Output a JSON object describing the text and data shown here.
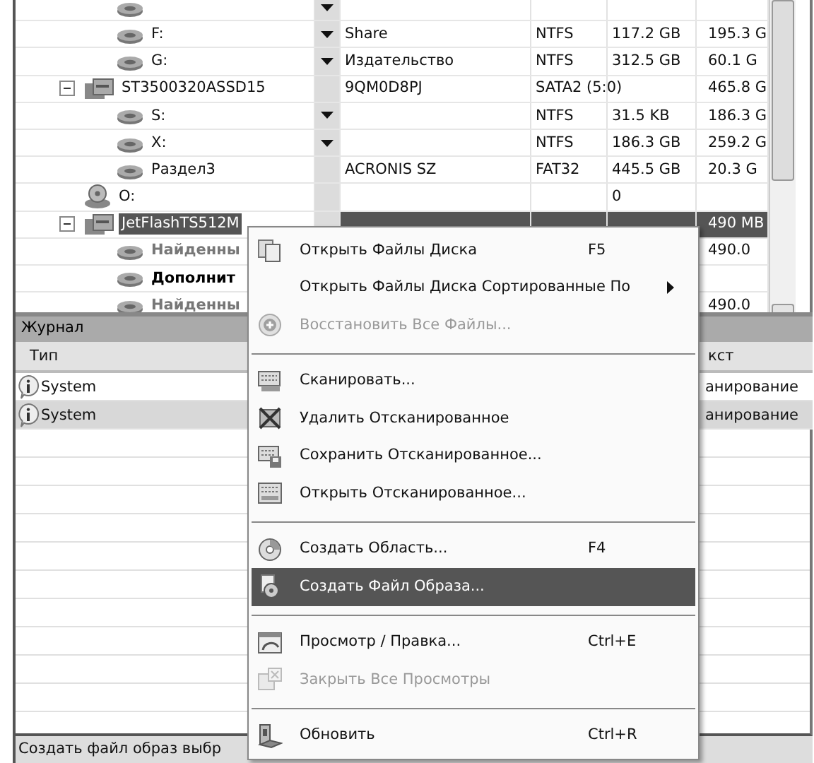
{
  "tree": [
    {
      "children": [
        {
          "kind": "partition",
          "dropdown": true,
          "selected": false
        },
        {
          "kind": "partition",
          "name": "F:",
          "dropdown": true,
          "label": "Share",
          "fs": "NTFS",
          "size": "117.2 GB",
          "total": "195.3 G",
          "selected": false
        },
        {
          "kind": "partition",
          "name": "G:",
          "dropdown": true,
          "label": "Издательство",
          "fs": "NTFS",
          "size": "312.5 GB",
          "total": "60.1 G",
          "selected": false
        }
      ]
    },
    {
      "kind": "disk",
      "name": "ST3500320ASSD15",
      "expanded": true,
      "label": "9QM0D8PJ",
      "fs": "SATA2 (5:0)",
      "total": "465.8 G",
      "selected": false,
      "children": [
        {
          "kind": "partition",
          "name": "S:",
          "dropdown": true,
          "fs": "NTFS",
          "size": "31.5 KB",
          "total": "186.3 G",
          "selected": false
        },
        {
          "kind": "partition",
          "name": "X:",
          "dropdown": true,
          "fs": "NTFS",
          "size": "186.3 GB",
          "total": "259.2 G",
          "selected": false
        },
        {
          "kind": "partition",
          "name": "Раздел3",
          "dropdown": false,
          "label": "ACRONIS SZ",
          "fs": "FAT32",
          "size": "445.5 GB",
          "total": "20.3 G",
          "selected": false
        }
      ]
    },
    {
      "kind": "optical",
      "name": "O:",
      "size": "0",
      "selected": false
    },
    {
      "kind": "disk",
      "name": "JetFlashTS512M",
      "expanded": true,
      "total": "490 MB",
      "selected": true,
      "children": [
        {
          "kind": "found",
          "name": "Найденны",
          "total": "490.0",
          "selected": false
        },
        {
          "kind": "additional",
          "name": "Дополнит",
          "selected": false
        },
        {
          "kind": "found",
          "name": "Найденны",
          "total": "490.0",
          "selected": false
        }
      ]
    }
  ],
  "journal": {
    "title": "Журнал",
    "columns": [
      "Тип",
      "кст"
    ],
    "rows": [
      {
        "type": "System",
        "column_3": "анирование",
        "selected": false
      },
      {
        "type": "System",
        "column_3": "анирование",
        "selected": true
      }
    ]
  },
  "status_bar": "Создать файл образ выбр",
  "context_menu": [
    {
      "kind": "item",
      "label": "Открыть Файлы Диска",
      "shortcut": "F5",
      "submenu": false,
      "disabled": false,
      "selected": false
    },
    {
      "kind": "item",
      "label": "Открыть Файлы Диска Сортированные По",
      "submenu": true,
      "disabled": false,
      "selected": false
    },
    {
      "kind": "item",
      "label": "Восстановить Все Файлы...",
      "submenu": false,
      "disabled": true,
      "selected": false
    },
    {
      "kind": "separator"
    },
    {
      "kind": "item",
      "label": "Сканировать...",
      "submenu": false,
      "disabled": false,
      "selected": false
    },
    {
      "kind": "item",
      "label": "Удалить Отсканированное",
      "submenu": false,
      "disabled": false,
      "selected": false
    },
    {
      "kind": "item",
      "label": "Сохранить Отсканированное...",
      "submenu": false,
      "disabled": false,
      "selected": false
    },
    {
      "kind": "item",
      "label": "Открыть Отсканированное...",
      "submenu": false,
      "disabled": false,
      "selected": false
    },
    {
      "kind": "separator"
    },
    {
      "kind": "item",
      "label": "Создать Область...",
      "shortcut": "F4",
      "submenu": false,
      "disabled": false,
      "selected": false
    },
    {
      "kind": "item",
      "label": "Создать Файл Образа...",
      "submenu": false,
      "disabled": false,
      "selected": true
    },
    {
      "kind": "separator"
    },
    {
      "kind": "item",
      "label": "Просмотр / Правка...",
      "shortcut": "Ctrl+E",
      "submenu": false,
      "disabled": false,
      "selected": false
    },
    {
      "kind": "item",
      "label": "Закрыть Все Просмотры",
      "submenu": false,
      "disabled": true,
      "selected": false
    },
    {
      "kind": "separator"
    },
    {
      "kind": "item",
      "label": "Обновить",
      "shortcut": "Ctrl+R",
      "submenu": false,
      "disabled": false,
      "selected": false
    }
  ]
}
